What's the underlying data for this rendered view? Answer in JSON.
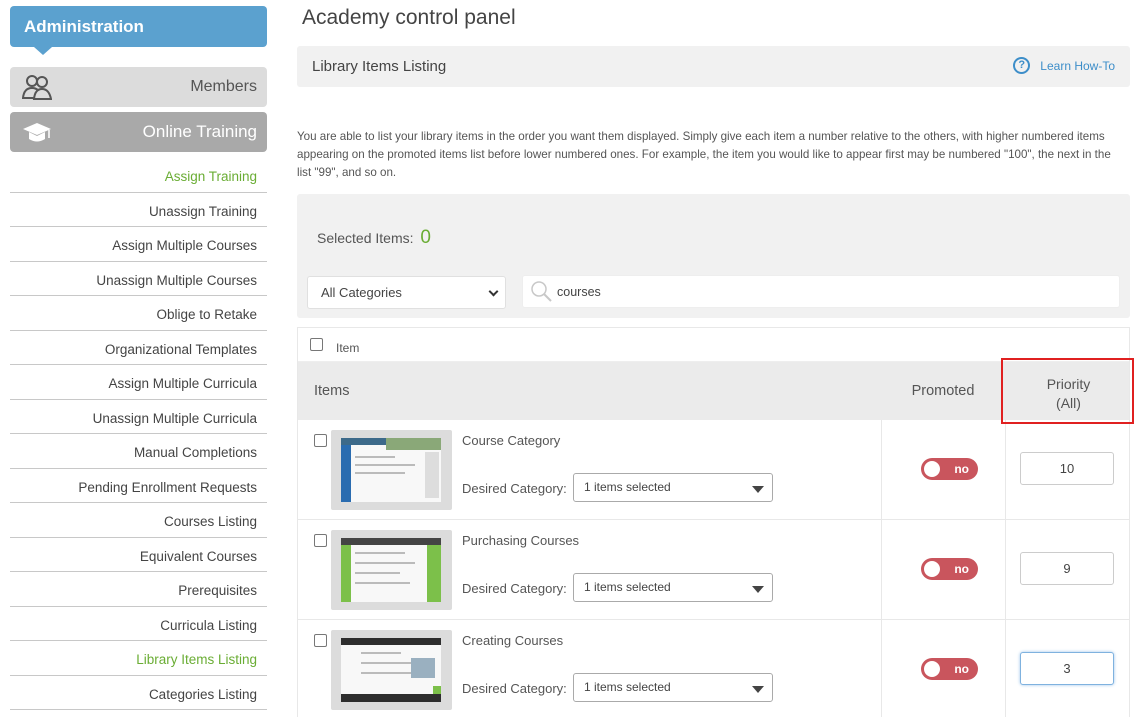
{
  "sidebar": {
    "header": "Administration",
    "members_label": "Members",
    "online_training_label": "Online Training",
    "items": [
      {
        "label": "Assign Training",
        "highlight": true
      },
      {
        "label": "Unassign Training"
      },
      {
        "label": "Assign Multiple Courses"
      },
      {
        "label": "Unassign Multiple Courses"
      },
      {
        "label": "Oblige to Retake"
      },
      {
        "label": "Organizational Templates"
      },
      {
        "label": "Assign Multiple Curricula"
      },
      {
        "label": "Unassign Multiple Curricula"
      },
      {
        "label": "Manual Completions"
      },
      {
        "label": "Pending Enrollment Requests"
      },
      {
        "label": "Courses Listing"
      },
      {
        "label": "Equivalent Courses"
      },
      {
        "label": "Prerequisites"
      },
      {
        "label": "Curricula Listing"
      },
      {
        "label": "Library Items Listing",
        "highlight": true
      },
      {
        "label": "Categories Listing"
      }
    ]
  },
  "page": {
    "title": "Academy control panel",
    "section_title": "Library Items Listing",
    "learn_how": "Learn How-To",
    "description": "You are able to list your library items in the order you want them displayed. Simply give each item a number relative to the others, with higher numbered items appearing on the promoted items list before lower numbered ones. For example, the item you would like to appear first may be numbered \"100\", the next in the list \"99\", and so on."
  },
  "selection": {
    "label": "Selected Items:",
    "count": "0",
    "category_select": "All Categories",
    "search_value": "courses"
  },
  "table": {
    "select_all_label": "Item",
    "col_items": "Items",
    "col_promoted": "Promoted",
    "col_priority_line1": "Priority",
    "col_priority_line2": "(All)",
    "desired_label": "Desired Category:",
    "rows": [
      {
        "title": "Course Category",
        "category": "1 items selected",
        "promoted": "no",
        "priority": "10"
      },
      {
        "title": "Purchasing Courses",
        "category": "1 items selected",
        "promoted": "no",
        "priority": "9"
      },
      {
        "title": "Creating Courses",
        "category": "1 items selected",
        "promoted": "no",
        "priority": "3"
      }
    ]
  },
  "colors": {
    "accent_blue": "#5ba1cf",
    "green": "#6aad34",
    "toggle_red": "#c9555d",
    "highlight_red": "#e02020"
  }
}
